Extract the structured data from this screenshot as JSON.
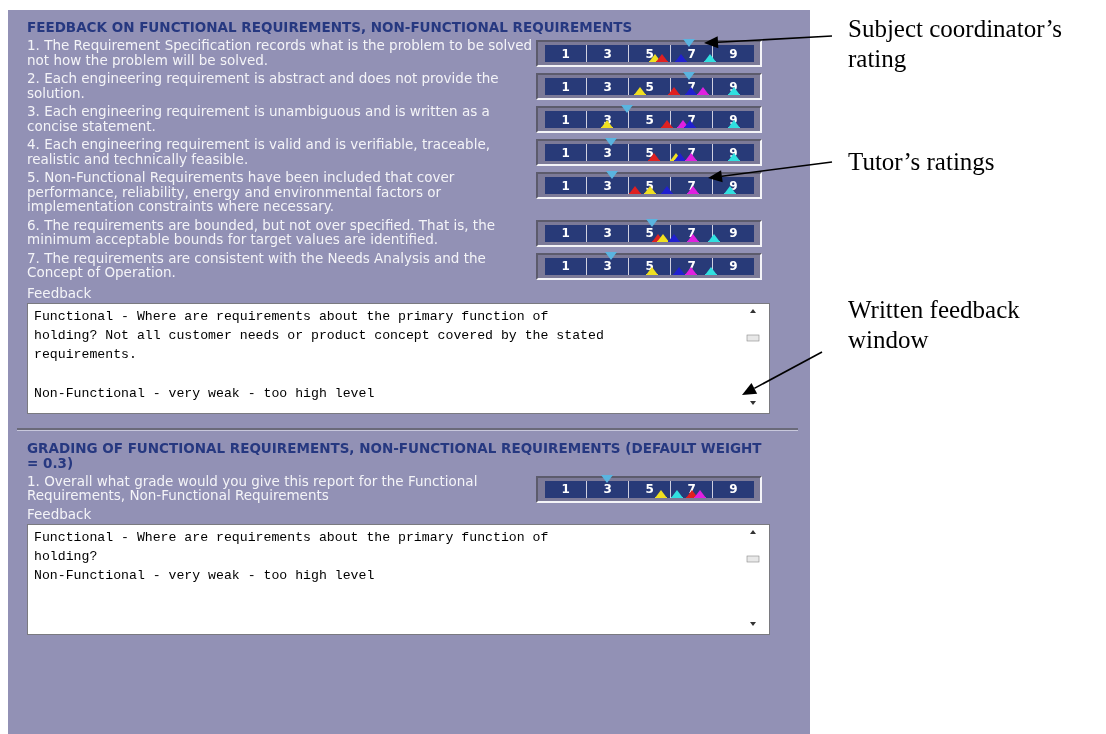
{
  "sections": [
    {
      "heading": "FEEDBACK ON FUNCTIONAL REQUIREMENTS, NON-FUNCTIONAL REQUIREMENTS",
      "criteria": [
        {
          "text": "1. The Requirement Specification records what is the problem to be solved not how the problem will be solved.",
          "scale": [
            "1",
            "3",
            "5",
            "7",
            "9"
          ],
          "markers": [
            {
              "kind": "coordinator",
              "color": "#5ab4e0",
              "level": 0.695
            },
            {
              "kind": "tutor",
              "color": "#f0e020",
              "level": 0.53
            },
            {
              "kind": "tutor",
              "color": "#e02020",
              "level": 0.566
            },
            {
              "kind": "tutor",
              "color": "#2020d0",
              "level": 0.655
            },
            {
              "kind": "tutor",
              "color": "#30e0e0",
              "level": 0.797
            }
          ]
        },
        {
          "text": "2. Each engineering requirement is abstract and does not provide the solution.",
          "scale": [
            "1",
            "3",
            "5",
            "7",
            "9"
          ],
          "markers": [
            {
              "kind": "coordinator",
              "color": "#5ab4e0",
              "level": 0.695
            },
            {
              "kind": "tutor",
              "color": "#f0e020",
              "level": 0.456
            },
            {
              "kind": "tutor",
              "color": "#e02020",
              "level": 0.623
            },
            {
              "kind": "tutor",
              "color": "#2020d0",
              "level": 0.706
            },
            {
              "kind": "tutor",
              "color": "#e020e0",
              "level": 0.764
            },
            {
              "kind": "tutor",
              "color": "#30e0e0",
              "level": 0.914
            }
          ]
        },
        {
          "text": "3. Each engineering requirement is unambiguous and is written as a concise statement.",
          "scale": [
            "1",
            "3",
            "5",
            "7",
            "9"
          ],
          "markers": [
            {
              "kind": "coordinator",
              "color": "#5ab4e0",
              "level": 0.394
            },
            {
              "kind": "tutor",
              "color": "#f0e020",
              "level": 0.297
            },
            {
              "kind": "tutor",
              "color": "#e02020",
              "level": 0.586
            },
            {
              "kind": "tutor",
              "color": "#e020e0",
              "level": 0.667
            },
            {
              "kind": "tutor",
              "color": "#2020d0",
              "level": 0.698
            },
            {
              "kind": "tutor",
              "color": "#30e0e0",
              "level": 0.914
            }
          ]
        },
        {
          "text": "4. Each engineering requirement is valid and is verifiable, traceable, realistic and technically feasible.",
          "scale": [
            "1",
            "3",
            "5",
            "7",
            "9"
          ],
          "markers": [
            {
              "kind": "coordinator",
              "color": "#5ab4e0",
              "level": 0.316
            },
            {
              "kind": "tutor",
              "color": "#e02020",
              "level": 0.527
            },
            {
              "kind": "tutor",
              "color": "#f0e020",
              "level": 0.633
            },
            {
              "kind": "tutor",
              "color": "#2020d0",
              "level": 0.652
            },
            {
              "kind": "tutor",
              "color": "#e020e0",
              "level": 0.706
            },
            {
              "kind": "tutor",
              "color": "#30e0e0",
              "level": 0.914
            }
          ]
        },
        {
          "text": "5. Non-Functional Requirements have been included that cover performance, reliability, energy and environmental factors or implementation constraints where necessary.",
          "scale": [
            "1",
            "3",
            "5",
            "7",
            "9"
          ],
          "markers": [
            {
              "kind": "coordinator",
              "color": "#5ab4e0",
              "level": 0.323
            },
            {
              "kind": "tutor",
              "color": "#e02020",
              "level": 0.434
            },
            {
              "kind": "tutor",
              "color": "#f0e020",
              "level": 0.506
            },
            {
              "kind": "tutor",
              "color": "#2020d0",
              "level": 0.586
            },
            {
              "kind": "tutor",
              "color": "#e020e0",
              "level": 0.714
            },
            {
              "kind": "tutor",
              "color": "#30e0e0",
              "level": 0.894
            }
          ]
        },
        {
          "text": "6. The requirements are bounded, but not over specified. That is, the minimum acceptable bounds for target values are identified.",
          "scale": [
            "1",
            "3",
            "5",
            "7",
            "9"
          ],
          "markers": [
            {
              "kind": "coordinator",
              "color": "#5ab4e0",
              "level": 0.516
            },
            {
              "kind": "tutor",
              "color": "#e02020",
              "level": 0.545
            },
            {
              "kind": "tutor",
              "color": "#f0e020",
              "level": 0.569
            },
            {
              "kind": "tutor",
              "color": "#2020d0",
              "level": 0.623
            },
            {
              "kind": "tutor",
              "color": "#e020e0",
              "level": 0.714
            },
            {
              "kind": "tutor",
              "color": "#30e0e0",
              "level": 0.816
            }
          ]
        },
        {
          "text": "7. The requirements are consistent with the Needs Analysis and the Concept of Operation.",
          "scale": [
            "1",
            "3",
            "5",
            "7",
            "9"
          ],
          "markers": [
            {
              "kind": "coordinator",
              "color": "#5ab4e0",
              "level": 0.316
            },
            {
              "kind": "tutor",
              "color": "#f0e020",
              "level": 0.516
            },
            {
              "kind": "tutor",
              "color": "#2020d0",
              "level": 0.648
            },
            {
              "kind": "tutor",
              "color": "#e020e0",
              "level": 0.703
            },
            {
              "kind": "tutor",
              "color": "#30e0e0",
              "level": 0.8
            }
          ]
        }
      ],
      "feedback_label": "Feedback",
      "feedback": "Functional - Where are requirements about the primary function of\nholding? Not all customer needs or product concept covered by the stated\nrequirements.\n\nNon-Functional - very weak - too high level"
    },
    {
      "heading": "GRADING OF FUNCTIONAL REQUIREMENTS, NON-FUNCTIONAL REQUIREMENTS (DEFAULT WEIGHT = 0.3)",
      "criteria": [
        {
          "text": "1. Overall what grade would you give this report for the Functional Requirements, Non-Functional Requirements",
          "scale": [
            "1",
            "3",
            "5",
            "7",
            "9"
          ],
          "markers": [
            {
              "kind": "coordinator",
              "color": "#5ab4e0",
              "level": 0.297
            },
            {
              "kind": "tutor",
              "color": "#f0e020",
              "level": 0.558
            },
            {
              "kind": "tutor",
              "color": "#30e0e0",
              "level": 0.636
            },
            {
              "kind": "tutor",
              "color": "#e02020",
              "level": 0.709
            },
            {
              "kind": "tutor",
              "color": "#e020e0",
              "level": 0.745
            }
          ]
        }
      ],
      "feedback_label": "Feedback",
      "feedback": "Functional - Where are requirements about the primary function of\nholding?\nNon-Functional - very weak - too high level"
    }
  ],
  "annotations": [
    {
      "text": "Subject coordinator’s rating"
    },
    {
      "text": "Tutor’s ratings"
    },
    {
      "text": "Written feedback window"
    }
  ]
}
